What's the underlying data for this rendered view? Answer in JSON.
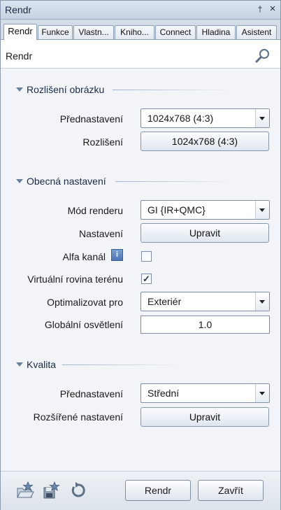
{
  "window": {
    "title": "Rendr",
    "pin_glyph": "†",
    "close_glyph": "×"
  },
  "tabs": [
    "Rendr",
    "Funkce",
    "Vlastn...",
    "Kniho...",
    "Connect",
    "Hladina",
    "Asistent"
  ],
  "header": {
    "title": "Rendr",
    "search_icon": "search-icon"
  },
  "sections": {
    "resolution": {
      "title": "Rozlišení obrázku",
      "preset_label": "Přednastavení",
      "preset_value": "1024x768  (4:3)",
      "resolution_label": "Rozlišení",
      "resolution_button": "1024x768  (4:3)"
    },
    "general": {
      "title": "Obecná nastavení",
      "mode_label": "Mód renderu",
      "mode_value": "GI {IR+QMC}",
      "settings_label": "Nastavení",
      "settings_button": "Upravit",
      "alpha_label": "Alfa kanál",
      "alpha_checked": false,
      "terrain_label": "Virtuální rovina terénu",
      "terrain_checked": true,
      "optimize_label": "Optimalizovat pro",
      "optimize_value": "Exteriér",
      "gi_label": "Globální osvětlení",
      "gi_value": "1.0"
    },
    "quality": {
      "title": "Kvalita",
      "preset_label": "Přednastavení",
      "preset_value": "Střední",
      "advanced_label": "Rozšířené nastavení",
      "advanced_button": "Upravit"
    }
  },
  "footer": {
    "render_button": "Rendr",
    "close_button": "Zavřít"
  }
}
